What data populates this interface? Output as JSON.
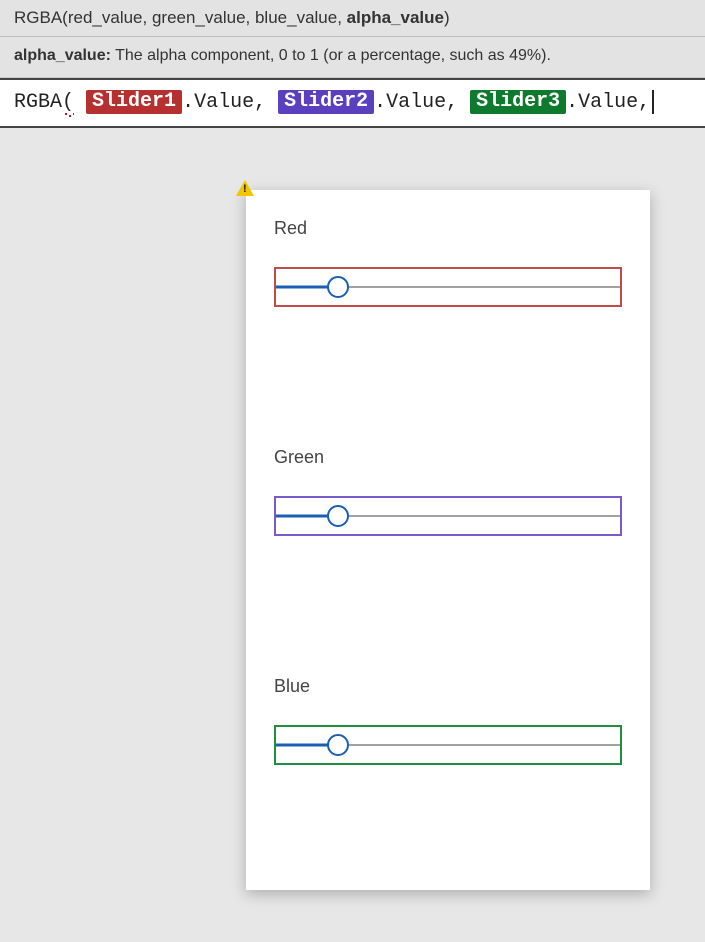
{
  "tooltip": {
    "signature_prefix": "RGBA(red_value, green_value, blue_value, ",
    "signature_bold": "alpha_value",
    "signature_suffix": ")",
    "param_name": "alpha_value:",
    "param_desc": " The alpha component, 0 to 1 (or a percentage, such as 49%)."
  },
  "formula": {
    "func": "RGBA",
    "open": "(",
    "slider1_chip": "Slider1",
    "dot_value1": ".Value, ",
    "slider2_chip": "Slider2",
    "dot_value2": ".Value, ",
    "slider3_chip": "Slider3",
    "dot_value3": ".Value, ",
    "chip_colors": {
      "slider1": "#b63030",
      "slider2": "#5a3fbf",
      "slider3": "#0d7a2e"
    }
  },
  "sliders": [
    {
      "label": "Red",
      "border": "box-red",
      "percent": 18
    },
    {
      "label": "Green",
      "border": "box-purple",
      "percent": 18
    },
    {
      "label": "Blue",
      "border": "box-green",
      "percent": 18
    }
  ],
  "icons": {
    "warning": "warning-icon"
  }
}
